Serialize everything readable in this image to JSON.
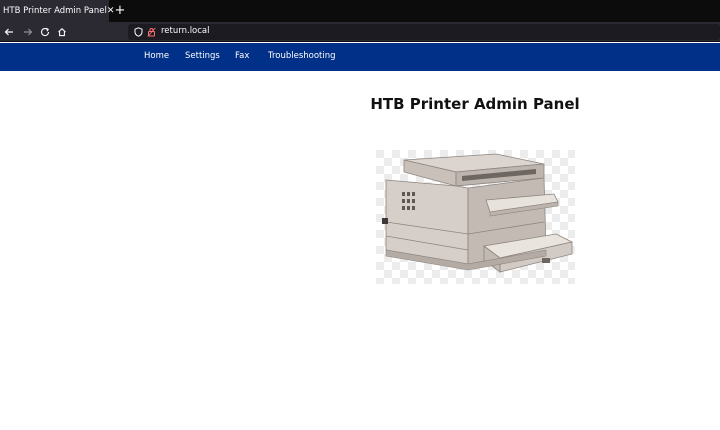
{
  "browser": {
    "tab_title": "HTB Printer Admin Panel",
    "tab_close_glyph": "✕",
    "new_tab_glyph": "+",
    "url": "return.local",
    "icons": [
      "back-arrow-icon",
      "forward-arrow-icon",
      "reload-icon",
      "home-icon",
      "shield-icon",
      "lock-icon"
    ]
  },
  "nav": {
    "links": [
      "Home",
      "Settings",
      "Fax",
      "Troubleshooting"
    ],
    "bg_color": "#003087"
  },
  "main": {
    "heading": "HTB Printer Admin Panel",
    "image_icon": "printer-icon"
  }
}
